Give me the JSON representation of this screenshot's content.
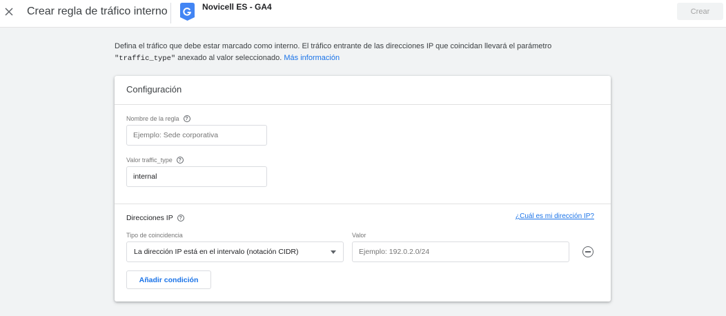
{
  "header": {
    "title": "Crear regla de tráfico interno",
    "property_name": "Novicell ES - GA4",
    "create_label": "Crear"
  },
  "intro": {
    "text_before": "Defina el tráfico que debe estar marcado como interno. El tráfico entrante de las direcciones IP que coincidan llevará el parámetro ",
    "param": "\"traffic_type\"",
    "text_after": " anexado al valor seleccionado. ",
    "link": "Más información"
  },
  "config": {
    "title": "Configuración",
    "rule_name": {
      "label": "Nombre de la regla",
      "placeholder": "Ejemplo: Sede corporativa",
      "value": ""
    },
    "traffic_type": {
      "label": "Valor traffic_type",
      "value": "internal"
    }
  },
  "ip": {
    "title": "Direcciones IP",
    "help_link": "¿Cuál es mi dirección IP?",
    "match_type_label": "Tipo de coincidencia",
    "match_type_value": "La dirección IP está en el intervalo (notación CIDR)",
    "value_label": "Valor",
    "value_placeholder": "Ejemplo: 192.0.2.0/24",
    "add_condition": "Añadir condición"
  },
  "icons": {
    "help_glyph": "?"
  }
}
